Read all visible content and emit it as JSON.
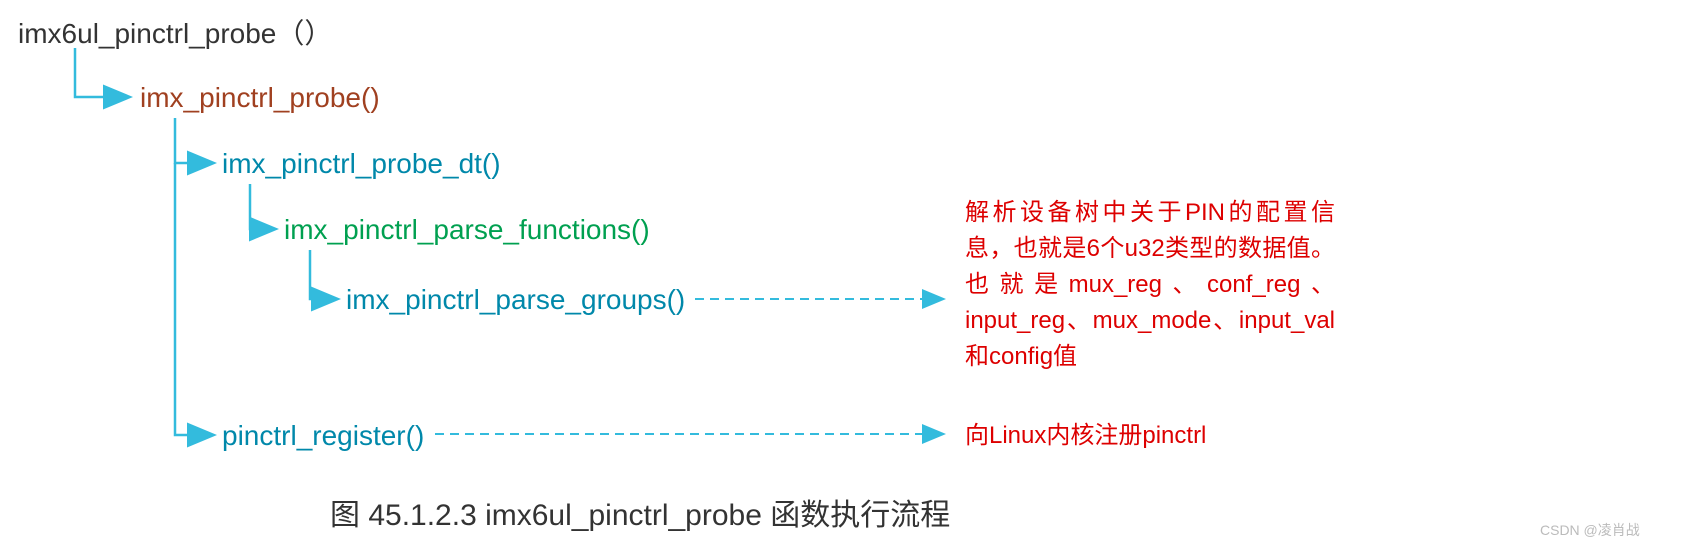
{
  "nodes": {
    "root": "imx6ul_pinctrl_probe（）",
    "l1": "imx_pinctrl_probe()",
    "l2a": "imx_pinctrl_probe_dt()",
    "l3": "imx_pinctrl_parse_functions()",
    "l4": "imx_pinctrl_parse_groups()",
    "l2b": "pinctrl_register()"
  },
  "annotations": {
    "parseGroups": "解析设备树中关于PIN的配置信息，也就是6个u32类型的数据值。也就是mux_reg、conf_reg、input_reg、mux_mode、input_val和config值",
    "register": "向Linux内核注册pinctrl"
  },
  "caption": "图 45.1.2.3 imx6ul_pinctrl_probe 函数执行流程",
  "watermark": "CSDN @凌肖战"
}
